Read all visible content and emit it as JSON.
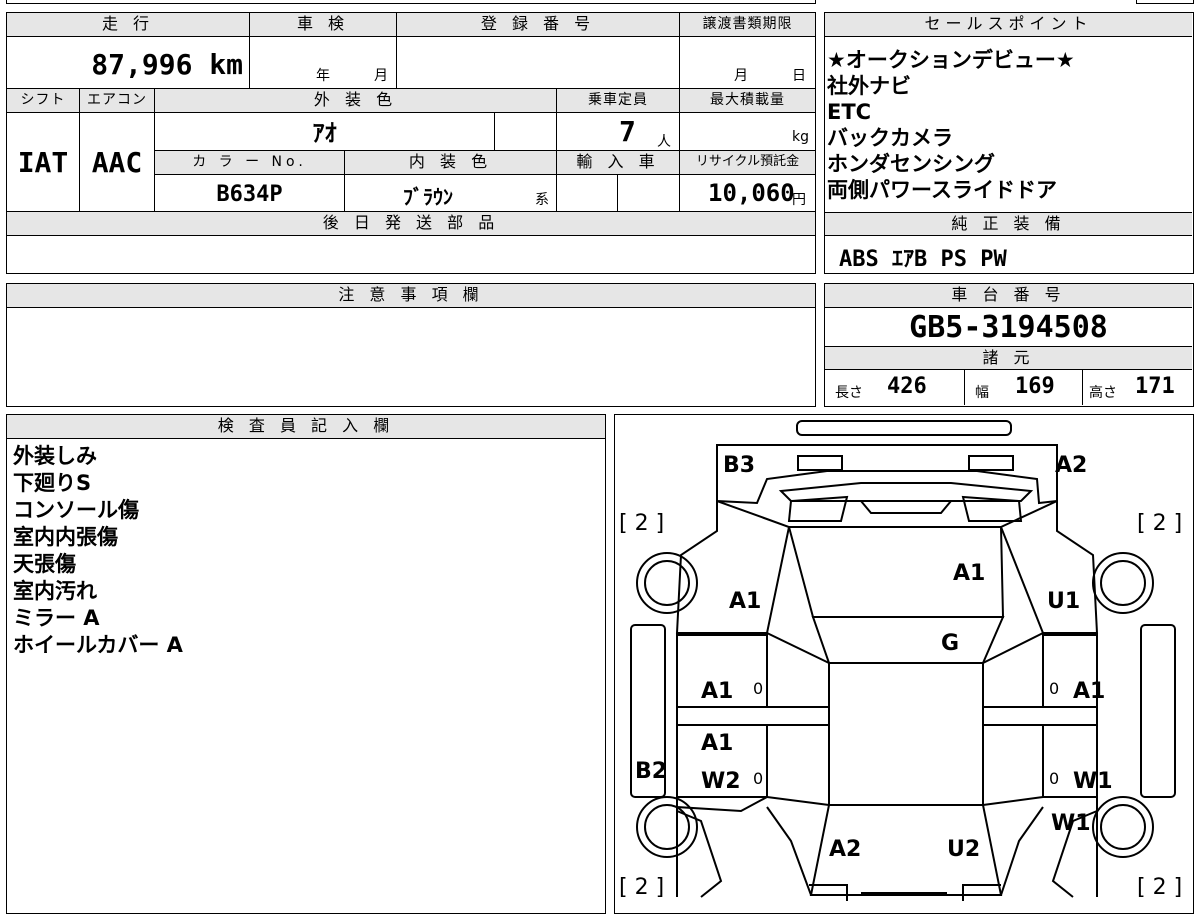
{
  "top_table": {
    "mileage_label": "走 行",
    "mileage": "87,996 km",
    "inspection_label": "車 検",
    "inspection_year": "年",
    "inspection_month": "月",
    "registration_label": "登 録 番 号",
    "transfer_label": "譲渡書類期限",
    "transfer_month": "月",
    "transfer_day": "日",
    "shift_label": "シフト",
    "shift": "IAT",
    "aircon_label": "エアコン",
    "aircon": "AAC",
    "exterior_label": "外 装 色",
    "exterior": "ｱｵ",
    "capacity_label": "乗車定員",
    "capacity": "7",
    "capacity_unit": "人",
    "max_load_label": "最大積載量",
    "max_load_unit": "kg",
    "color_no_label": "カ ラ ー No.",
    "color_no": "B634P",
    "interior_label": "内 装 色",
    "interior": "ﾌﾞﾗｳﾝ",
    "interior_suffix": "系",
    "import_label": "輸 入 車",
    "recycle_label": "リサイクル預託金",
    "recycle": "10,060",
    "recycle_unit": "円",
    "later_parts_label": "後 日 発 送 部 品"
  },
  "sales_points": {
    "label": "セールスポイント",
    "items": [
      "★オークションデビュー★",
      "社外ナビ",
      "ETC",
      "バックカメラ",
      "ホンダセンシング",
      "両側パワースライドドア"
    ]
  },
  "standard_equipment": {
    "label": "純 正 装 備",
    "value": "ABS ｴｱB PS PW"
  },
  "notes": {
    "label": "注 意 事 項 欄"
  },
  "chassis": {
    "label": "車 台 番 号",
    "value": "GB5-3194508"
  },
  "specs": {
    "label": "諸 元",
    "length_label": "長さ",
    "length": "426",
    "width_label": "幅",
    "width": "169",
    "height_label": "高さ",
    "height": "171"
  },
  "inspector": {
    "label": "検 査 員 記 入 欄",
    "items": [
      "外装しみ",
      "下廻りS",
      "コンソール傷",
      "室内内張傷",
      "天張傷",
      "室内汚れ",
      "ミラー A",
      "ホイールカバー A"
    ]
  },
  "diagram": {
    "tire_left_top": "[ 2 ]",
    "tire_right_top": "[ 2 ]",
    "tire_left_bottom": "[ 2 ]",
    "tire_right_bottom": "[ 2 ]",
    "marks": {
      "rear_left": "B3",
      "rear_right": "A2",
      "roof": "A1",
      "left_quarter": "A1",
      "right_quarter": "U1",
      "glass": "G",
      "left_rear_door": "A1",
      "right_rear_door": "A1",
      "left_front_door": "A1",
      "left_front_door_w": "W2",
      "left_sill": "B2",
      "right_front_door": "W1",
      "right_front_fender": "W1",
      "hood_left": "A2",
      "hood_right": "U2",
      "zero_1": "0",
      "zero_2": "0",
      "zero_3": "0",
      "zero_4": "0"
    }
  }
}
